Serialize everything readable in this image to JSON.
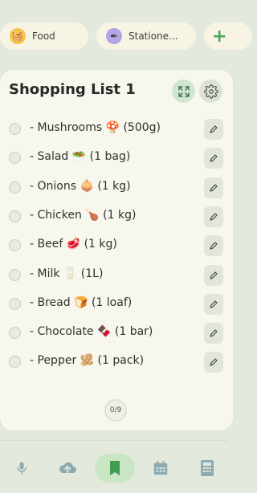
{
  "categories": [
    {
      "label": "Food",
      "icon": "basket-icon"
    },
    {
      "label": "Statione...",
      "icon": "pen-icon"
    }
  ],
  "list": {
    "title": "Shopping List 1",
    "items": [
      {
        "text": "- Mushrooms 🍄 (500g)",
        "checked": false
      },
      {
        "text": "- Salad 🥗 (1 bag)",
        "checked": false
      },
      {
        "text": "- Onions 🧅 (1 kg)",
        "checked": false
      },
      {
        "text": "- Chicken 🍗 (1 kg)",
        "checked": false
      },
      {
        "text": "- Beef 🥩 (1 kg)",
        "checked": false
      },
      {
        "text": "- Milk 🥛 (1L)",
        "checked": false
      },
      {
        "text": "- Bread 🍞 (1 loaf)",
        "checked": false
      },
      {
        "text": "- Chocolate 🍫 (1 bar)",
        "checked": false
      },
      {
        "text": "- Pepper 🫚 (1 pack)",
        "checked": false
      }
    ],
    "progress": "0/9"
  },
  "nav": {
    "items": [
      "microphone-icon",
      "cloud-upload-icon",
      "bookmark-icon",
      "calendar-icon",
      "calculator-icon"
    ],
    "active": "bookmark-icon"
  },
  "colors": {
    "accent": "#4ba45c",
    "card": "#f7f7ee",
    "background": "#e3e9dc"
  }
}
